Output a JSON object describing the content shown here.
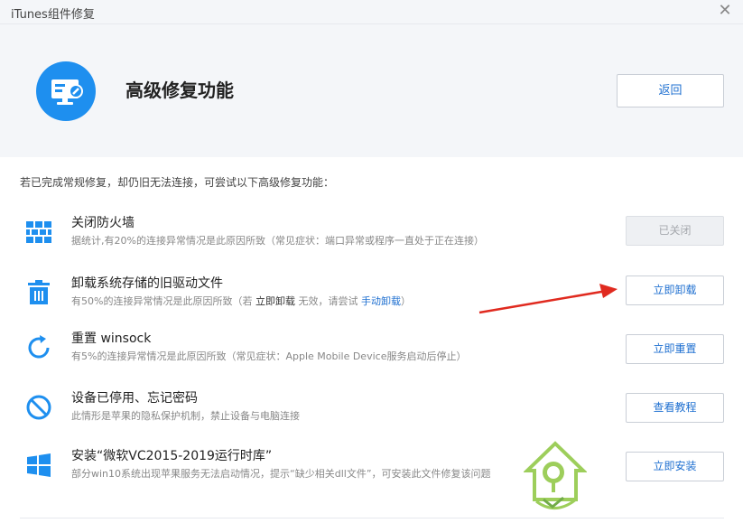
{
  "window": {
    "title": "iTunes组件修复",
    "close_icon": "close-icon"
  },
  "header": {
    "title": "高级修复功能",
    "back_label": "返回",
    "logo_icon": "monitor-wrench-icon"
  },
  "intro": "若已完成常规修复，却仍旧无法连接，可尝试以下高级修复功能：",
  "items": [
    {
      "name": "关闭防火墙",
      "desc": "据统计,有20%的连接异常情况是此原因所致（常见症状：端口异常或程序一直处于正在连接）",
      "button": "已关闭",
      "icon": "firewall-icon"
    },
    {
      "name": "卸载系统存储的旧驱动文件",
      "desc_parts": [
        "有50%的连接异常情况是此原因所致（若 ",
        "立即卸载",
        " 无效，请尝试 ",
        "手动卸载",
        "）"
      ],
      "button": "立即卸载",
      "icon": "trash-icon"
    },
    {
      "name": "重置 winsock",
      "desc": "有5%的连接异常情况是此原因所致（常见症状：Apple Mobile Device服务启动后停止）",
      "button": "立即重置",
      "icon": "refresh-icon"
    },
    {
      "name": "设备已停用、忘记密码",
      "desc": "此情形是苹果的隐私保护机制，禁止设备与电脑连接",
      "button": "查看教程",
      "icon": "prohibited-icon"
    },
    {
      "name": "安装“微软VC2015-2019运行时库”",
      "desc": "部分win10系统出现苹果服务无法启动情况，提示“缺少相关dll文件”，可安装此文件修复该问题",
      "button": "立即安装",
      "icon": "windows-icon"
    }
  ],
  "colors": {
    "accent": "#1e8fef",
    "link": "#1e6fd0",
    "arrow": "#e02a1f"
  }
}
